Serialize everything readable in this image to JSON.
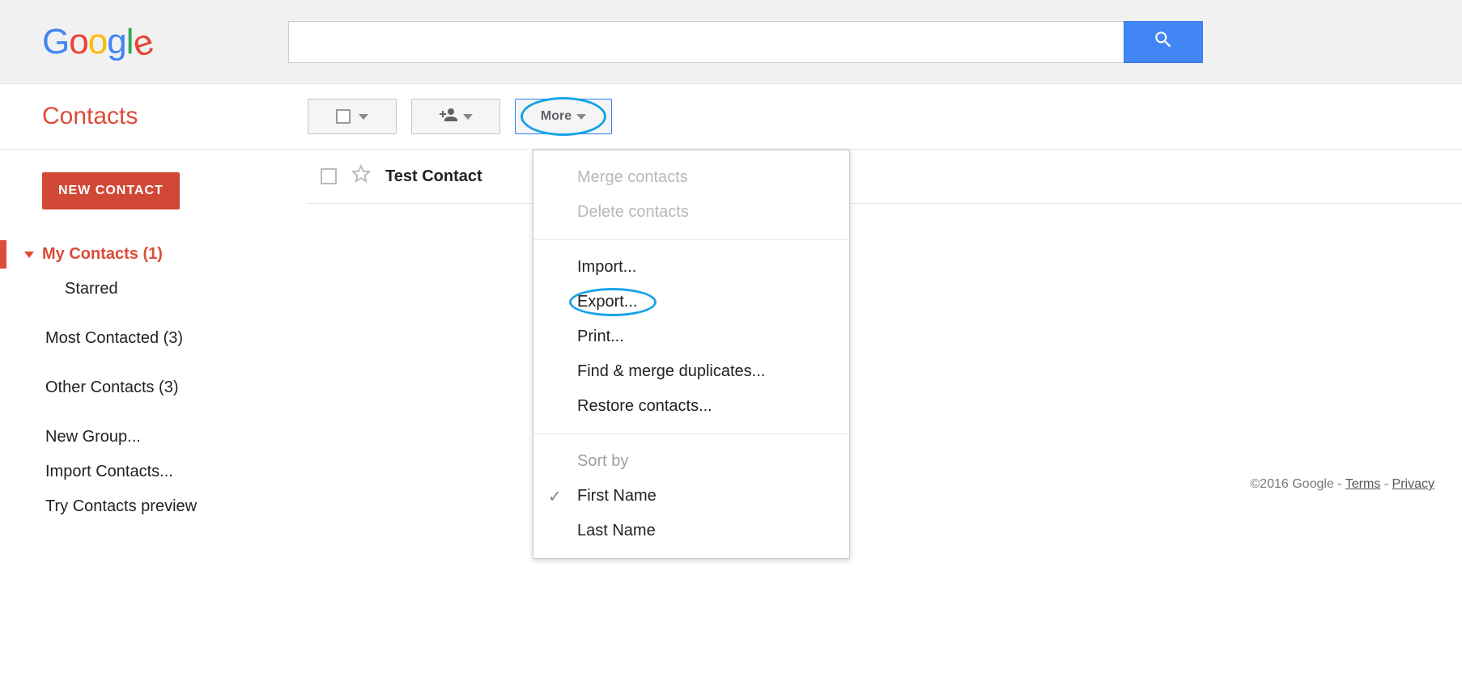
{
  "search": {
    "placeholder": ""
  },
  "app": {
    "title": "Contacts"
  },
  "toolbar": {
    "more_label": "More"
  },
  "sidebar": {
    "new_contact_label": "NEW CONTACT",
    "items": [
      {
        "label": "My Contacts (1)"
      },
      {
        "label": "Starred"
      },
      {
        "label": "Most Contacted (3)"
      },
      {
        "label": "Other Contacts (3)"
      },
      {
        "label": "New Group..."
      },
      {
        "label": "Import Contacts..."
      },
      {
        "label": "Try Contacts preview"
      }
    ]
  },
  "contact": {
    "name": "Test Contact"
  },
  "menu": {
    "merge": "Merge contacts",
    "delete": "Delete contacts",
    "import": "Import...",
    "export": "Export...",
    "print": "Print...",
    "find_merge": "Find & merge duplicates...",
    "restore": "Restore contacts...",
    "sort_by": "Sort by",
    "first_name": "First Name",
    "last_name": "Last Name"
  },
  "footer": {
    "copyright": "©2016 Google",
    "sep": " - ",
    "terms": "Terms",
    "privacy": "Privacy"
  }
}
